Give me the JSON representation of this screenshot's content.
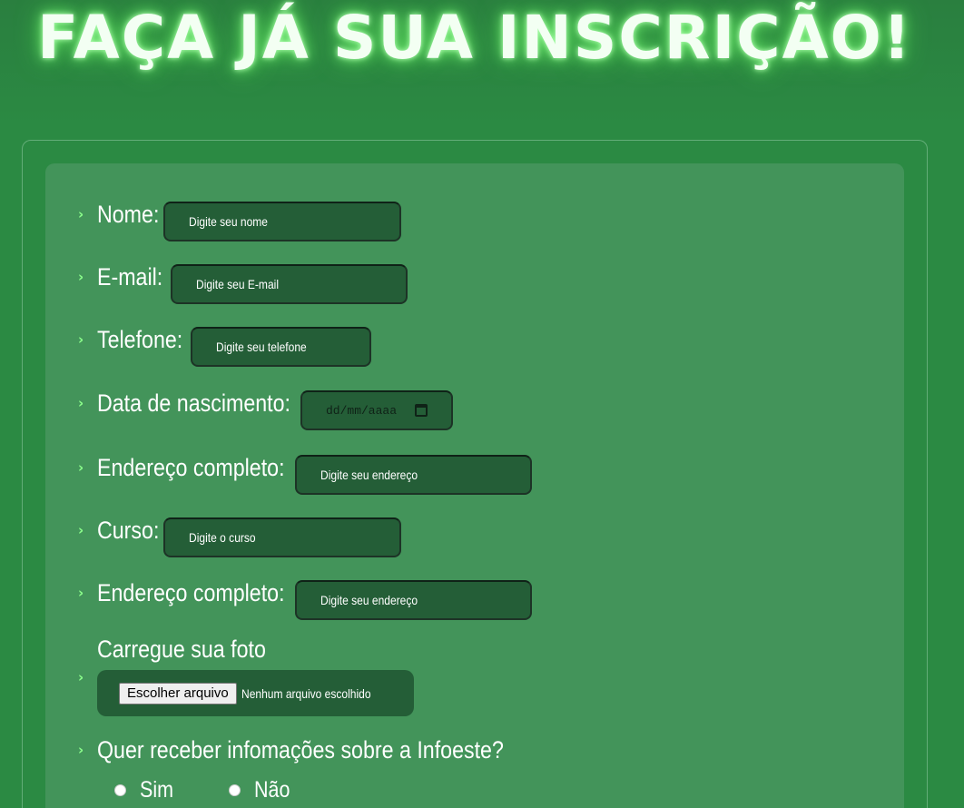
{
  "header": {
    "title": "FAÇA JÁ SUA INSCRIÇÃO!"
  },
  "form": {
    "fields": [
      {
        "label": "Nome:",
        "placeholder": "Digite seu nome"
      },
      {
        "label": "E-mail:",
        "placeholder": "Digite seu E-mail"
      },
      {
        "label": "Telefone:",
        "placeholder": "Digite seu telefone"
      },
      {
        "label": "Data de nascimento:",
        "placeholder": "dd/mm/aaaa"
      },
      {
        "label": "Endereço completo:",
        "placeholder": "Digite seu endereço"
      },
      {
        "label": "Curso:",
        "placeholder": "Digite o curso"
      },
      {
        "label": "Endereço completo:",
        "placeholder": "Digite seu endereço"
      }
    ],
    "upload": {
      "label": "Carregue sua foto",
      "button_label": "Escolher arquivo",
      "status": "Nenhum arquivo escolhido"
    },
    "info_question": {
      "label": "Quer receber infomações sobre a Infoeste?",
      "options": [
        "Sim",
        "Não"
      ]
    }
  },
  "icons": {
    "bullet": "chevron-right-icon",
    "date": "calendar-icon"
  },
  "colors": {
    "background": "#2b8a43",
    "card": "#43945a",
    "input": "#245e37",
    "chevron": "#8cff8c",
    "title_glow": "#78f278"
  }
}
